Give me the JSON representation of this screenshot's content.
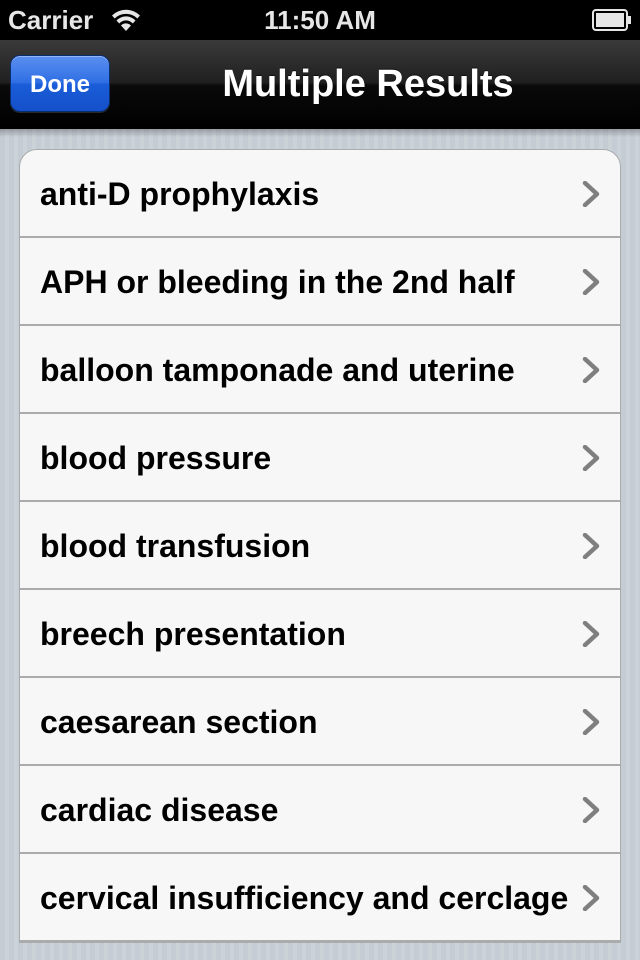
{
  "status_bar": {
    "carrier": "Carrier",
    "time": "11:50 AM",
    "wifi_icon": "wifi-icon",
    "battery_icon": "battery-icon"
  },
  "nav_bar": {
    "done_label": "Done",
    "title": "Multiple Results"
  },
  "colors": {
    "done_button": "#2f6fe4",
    "nav_background": "#000000",
    "table_background": "#f7f7f7",
    "chevron": "#7f7f7f"
  },
  "results": [
    {
      "label": "anti-D prophylaxis",
      "icon": "chevron-right-icon"
    },
    {
      "label": "APH or bleeding in the 2nd half",
      "icon": "chevron-right-icon"
    },
    {
      "label": "balloon tamponade and uterine",
      "icon": "chevron-right-icon"
    },
    {
      "label": "blood pressure",
      "icon": "chevron-right-icon"
    },
    {
      "label": "blood transfusion",
      "icon": "chevron-right-icon"
    },
    {
      "label": "breech presentation",
      "icon": "chevron-right-icon"
    },
    {
      "label": "caesarean section",
      "icon": "chevron-right-icon"
    },
    {
      "label": "cardiac disease",
      "icon": "chevron-right-icon"
    },
    {
      "label": "cervical insufficiency and cerclage",
      "icon": "chevron-right-icon"
    }
  ]
}
